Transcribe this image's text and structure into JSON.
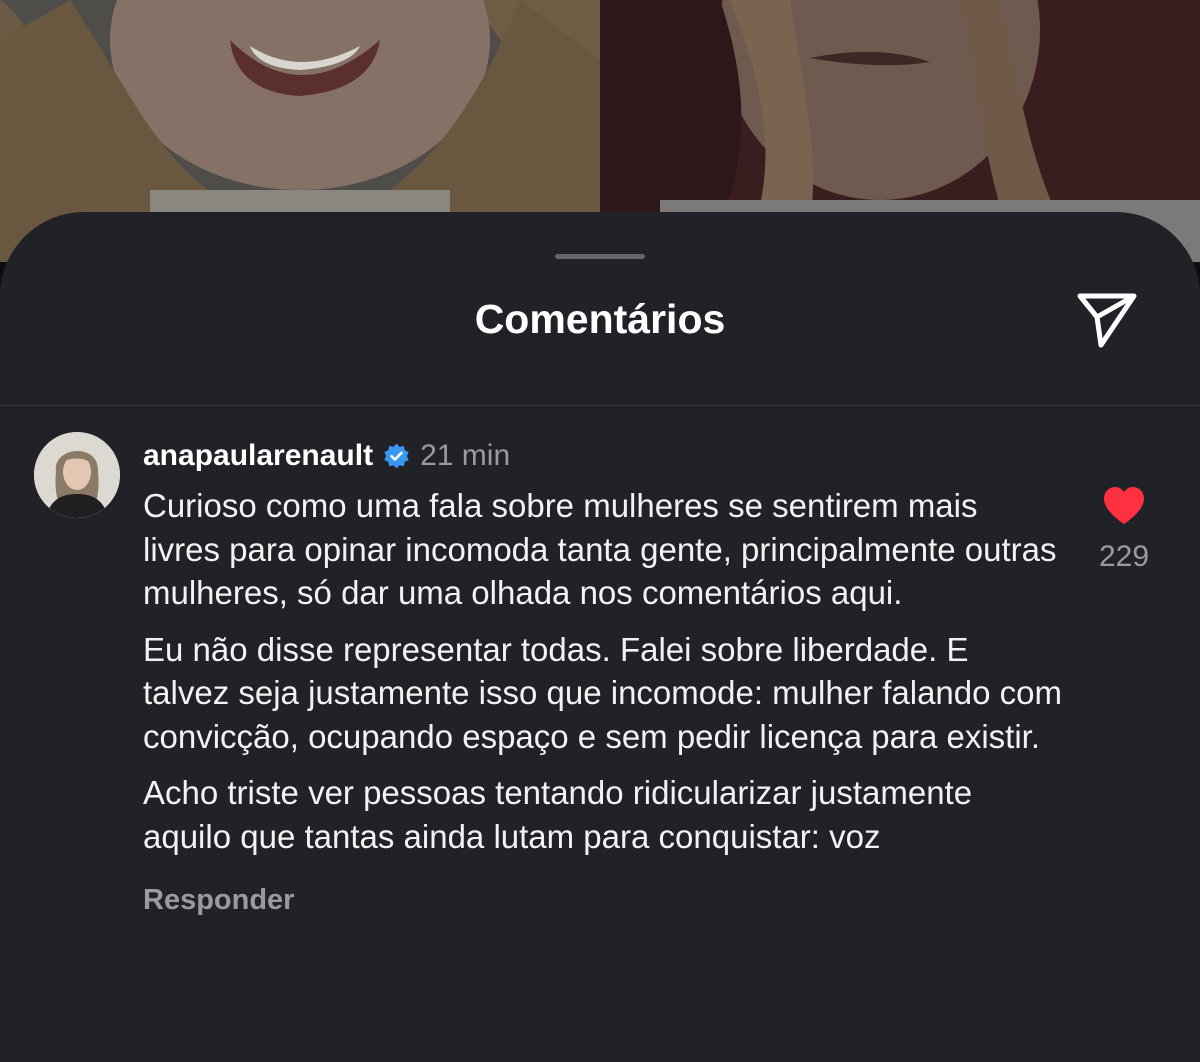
{
  "sheet": {
    "title": "Comentários",
    "share_icon": "send-icon"
  },
  "comment": {
    "username": "anapaularenault",
    "verified": true,
    "time": "21 min",
    "paragraphs": [
      "Curioso como uma fala sobre mulheres se sentirem mais livres para opinar incomoda tanta gente, principalmente outras mulheres, só dar uma olhada nos comentários aqui.",
      "Eu não disse representar todas. Falei sobre liberdade. E talvez seja justamente isso que incomode: mulher falando com convicção, ocupando espaço e sem pedir licença para existir.",
      "Acho triste ver pessoas tentando ridicularizar justamente aquilo que tantas ainda lutam para conquistar: voz"
    ],
    "reply_label": "Responder",
    "likes": "229",
    "liked": true
  },
  "colors": {
    "sheet_background": "#212227",
    "text_primary": "#ffffff",
    "text_secondary": "#9a9ba1",
    "verified_badge": "#3897f0",
    "like_heart": "#ff3040"
  }
}
